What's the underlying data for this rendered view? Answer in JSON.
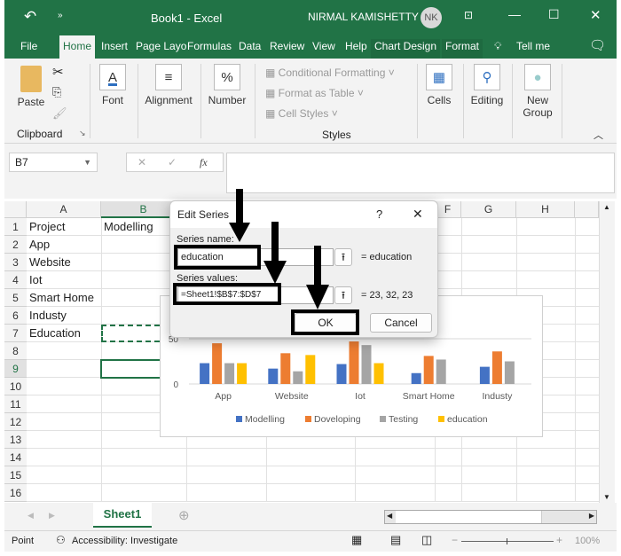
{
  "window": {
    "title": "Book1 - Excel",
    "user": "NIRMAL KAMISHETTY",
    "avatar": "NK"
  },
  "tabs": [
    "File",
    "Home",
    "Insert",
    "Page Layo",
    "Formulas",
    "Data",
    "Review",
    "View",
    "Help",
    "Chart Design",
    "Format",
    "Tell me"
  ],
  "active_tab": "Home",
  "ribbon": {
    "paste": "Paste",
    "clipboard": "Clipboard",
    "font": "Font",
    "alignment": "Alignment",
    "number": "Number",
    "cond_format": "Conditional Formatting",
    "format_table": "Format as Table",
    "cell_styles": "Cell Styles",
    "styles": "Styles",
    "cells": "Cells",
    "editing": "Editing",
    "new_group_1": "New",
    "new_group_2": "Group"
  },
  "formula_bar": {
    "name_box": "B7",
    "fx": "fx",
    "formula": ""
  },
  "columns": [
    "A",
    "B",
    "C",
    "D",
    "E",
    "F",
    "G",
    "H"
  ],
  "rows": [
    "1",
    "2",
    "3",
    "4",
    "5",
    "6",
    "7",
    "8",
    "9",
    "10",
    "11",
    "12",
    "13",
    "14",
    "15",
    "16"
  ],
  "cells": {
    "A1": "Project",
    "B1": "Modelling",
    "A2": "App",
    "A3": "Website",
    "A4": "Iot",
    "A5": "Smart Home",
    "A6": "Industy",
    "A7": "Education"
  },
  "dialog": {
    "title": "Edit Series",
    "help": "?",
    "close": "✕",
    "name_label": "Series name:",
    "name_value": "education",
    "name_result": "= education",
    "values_label": "Series values:",
    "values_value": "=Sheet1!$B$7:$D$7",
    "values_result": "= 23, 32, 23",
    "ok": "OK",
    "cancel": "Cancel"
  },
  "chart_data": {
    "type": "bar",
    "categories": [
      "App",
      "Website",
      "Iot",
      "Smart Home",
      "Industy"
    ],
    "series": [
      {
        "name": "Modelling",
        "color": "#4472c4",
        "values": [
          23,
          17,
          22,
          12,
          19
        ]
      },
      {
        "name": "Doveloping",
        "color": "#ed7d31",
        "values": [
          45,
          34,
          47,
          31,
          36
        ]
      },
      {
        "name": "Testing",
        "color": "#a5a5a5",
        "values": [
          23,
          14,
          43,
          27,
          25
        ]
      },
      {
        "name": "education",
        "color": "#ffc000",
        "values": [
          23,
          32,
          23,
          null,
          null
        ]
      }
    ],
    "yticks": [
      "0",
      "50"
    ],
    "ylim": [
      0,
      50
    ],
    "legend": "bottom"
  },
  "sheet_tab": "Sheet1",
  "status": {
    "mode": "Point",
    "accessibility": "Accessibility: Investigate",
    "zoom": "100%"
  },
  "colors": {
    "excel_green": "#217346"
  }
}
